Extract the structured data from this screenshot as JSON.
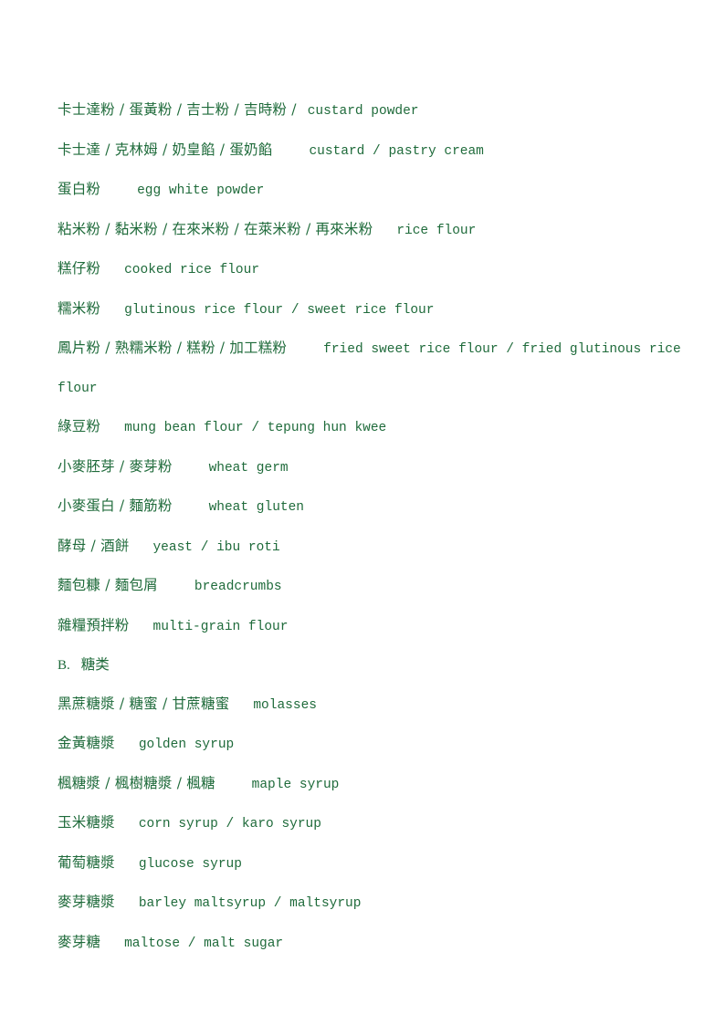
{
  "document": {
    "text_color": "#1f6b3b",
    "background_color": "#ffffff",
    "entries": [
      {
        "id": "custard-powder",
        "cn": "卡士達粉 / 蛋黃粉 / 吉士粉 / 吉時粉 /",
        "gap": "sm",
        "en": "custard powder"
      },
      {
        "id": "custard-pastry-cream",
        "cn": "卡士達 / 克林姆 / 奶皇餡 / 蛋奶餡",
        "gap": "lg",
        "en": "custard / pastry cream"
      },
      {
        "id": "egg-white-powder",
        "cn": "蛋白粉",
        "gap": "lg",
        "en": "egg white powder"
      },
      {
        "id": "rice-flour",
        "cn": "粘米粉 / 黏米粉 / 在來米粉 / 在萊米粉 / 再來米粉",
        "gap": "md",
        "en": "rice flour"
      },
      {
        "id": "cooked-rice-flour",
        "cn": "糕仔粉",
        "gap": "md",
        "en": "cooked rice flour"
      },
      {
        "id": "glutinous-rice-flour",
        "cn": "糯米粉",
        "gap": "md",
        "en": "glutinous rice flour / sweet rice flour"
      },
      {
        "id": "fried-sweet-rice-flour",
        "cn": "鳳片粉 / 熟糯米粉 / 糕粉 / 加工糕粉",
        "gap": "lg",
        "en": "fried sweet rice flour / fried glutinous rice flour"
      },
      {
        "id": "mung-bean-flour",
        "cn": "綠豆粉",
        "gap": "md",
        "en": "mung bean flour / tepung hun kwee"
      },
      {
        "id": "wheat-germ",
        "cn": "小麥胚芽 / 麥芽粉",
        "gap": "lg",
        "en": "wheat germ"
      },
      {
        "id": "wheat-gluten",
        "cn": "小麥蛋白 / 麵筋粉",
        "gap": "lg",
        "en": "wheat gluten"
      },
      {
        "id": "yeast",
        "cn": "酵母 / 酒餅",
        "gap": "md",
        "en": "yeast / ibu roti"
      },
      {
        "id": "breadcrumbs",
        "cn": "麵包糠 / 麵包屑",
        "gap": "lg",
        "en": "breadcrumbs"
      },
      {
        "id": "multi-grain-flour",
        "cn": "雜糧預拌粉",
        "gap": "md",
        "en": "multi-grain flour"
      },
      {
        "id": "section-b-sugars",
        "type": "heading",
        "marker": "B.",
        "label": "糖类"
      },
      {
        "id": "molasses",
        "cn": "黑蔗糖漿 / 糖蜜 / 甘蔗糖蜜",
        "gap": "md",
        "en": "molasses"
      },
      {
        "id": "golden-syrup",
        "cn": "金黃糖漿",
        "gap": "md",
        "en": "golden syrup"
      },
      {
        "id": "maple-syrup",
        "cn": "楓糖漿 / 楓樹糖漿 / 楓糖",
        "gap": "lg",
        "en": "maple syrup"
      },
      {
        "id": "corn-syrup",
        "cn": "玉米糖漿",
        "gap": "md",
        "en": "corn syrup / karo syrup"
      },
      {
        "id": "glucose-syrup",
        "cn": "葡萄糖漿",
        "gap": "md",
        "en": "glucose syrup"
      },
      {
        "id": "barley-malt-syrup",
        "cn": "麥芽糖漿",
        "gap": "md",
        "en": "barley maltsyrup / maltsyrup"
      },
      {
        "id": "maltose",
        "cn": "麥芽糖",
        "gap": "md",
        "en": "maltose / malt sugar"
      }
    ]
  }
}
